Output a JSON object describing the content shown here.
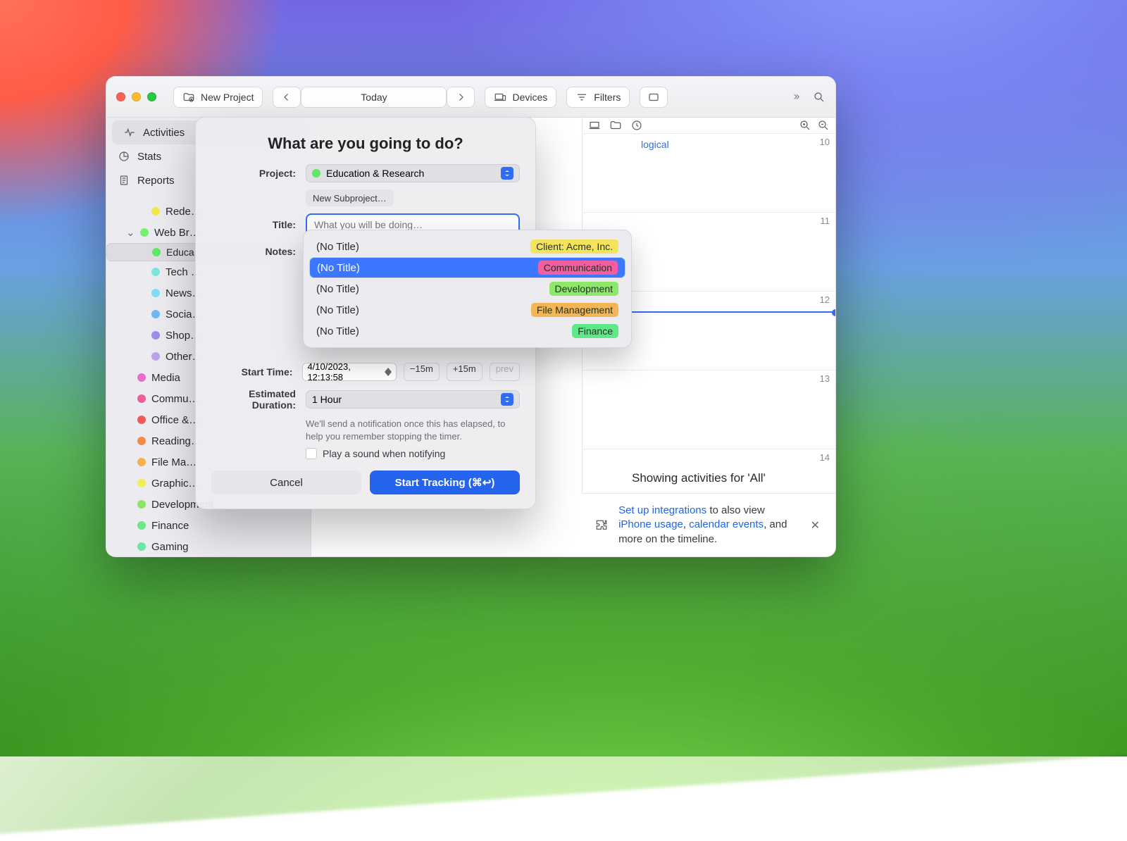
{
  "toolbar": {
    "new_project": "New Project",
    "today": "Today",
    "devices": "Devices",
    "filters": "Filters"
  },
  "sidebar": {
    "tabs": {
      "activities": "Activities",
      "stats": "Stats",
      "reports": "Reports"
    },
    "projects": [
      {
        "label": "Rede…",
        "color": "#f4e84e",
        "depth": 1
      },
      {
        "label": "Web Br…",
        "color": "#73f06e",
        "depth": 0,
        "expanded": true
      },
      {
        "label": "Educa…",
        "color": "#62e76a",
        "depth": 1,
        "selected": true
      },
      {
        "label": "Tech …",
        "color": "#7de7df",
        "depth": 1
      },
      {
        "label": "News…",
        "color": "#7fe0f3",
        "depth": 1
      },
      {
        "label": "Socia…",
        "color": "#6fb9f3",
        "depth": 1
      },
      {
        "label": "Shop…",
        "color": "#9a8df1",
        "depth": 1
      },
      {
        "label": "Other…",
        "color": "#bda3ec",
        "depth": 1
      },
      {
        "label": "Media",
        "color": "#e76fd0",
        "depth": 0
      },
      {
        "label": "Commu…",
        "color": "#ee5e99",
        "depth": 0
      },
      {
        "label": "Office &…",
        "color": "#f05a5a",
        "depth": 0
      },
      {
        "label": "Reading…",
        "color": "#f28a48",
        "depth": 0
      },
      {
        "label": "File Ma…",
        "color": "#f3b24a",
        "depth": 0
      },
      {
        "label": "Graphic…",
        "color": "#eeee57",
        "depth": 0
      },
      {
        "label": "Development",
        "color": "#8ae766",
        "depth": 0
      },
      {
        "label": "Finance",
        "color": "#6be785",
        "depth": 0
      },
      {
        "label": "Gaming",
        "color": "#6ae7a4",
        "depth": 0
      }
    ]
  },
  "timeline": {
    "hours": [
      "10",
      "11",
      "12",
      "13",
      "14"
    ]
  },
  "promo": {
    "prefix": "Set up integrations",
    "mid1": " to also view ",
    "lnk_iphone": "iPhone usage",
    "sep": ", ",
    "lnk_cal": "calendar events",
    "suffix": ", and more on the timeline."
  },
  "modal": {
    "heading": "What are you going to do?",
    "project_label": "Project:",
    "project_value": "Education & Research",
    "project_color": "#63e56c",
    "new_subproject": "New Subproject…",
    "title_label": "Title:",
    "title_placeholder": "What you will be doing…",
    "notes_label": "Notes:",
    "start_label": "Start Time:",
    "start_value": "4/10/2023, 12:13:58",
    "minus15": "−15m",
    "plus15": "+15m",
    "prev": "prev",
    "duration_label": "Estimated Duration:",
    "duration_value": "1 Hour",
    "hint": "We'll send a notification once this has elapsed, to help you remember stopping the timer.",
    "sound_label": "Play a sound when notifying",
    "cancel": "Cancel",
    "start": "Start Tracking (⌘↩︎)"
  },
  "suggestions": [
    {
      "title": "(No Title)",
      "tag": "Client: Acme, Inc.",
      "tag_bg": "#f4e35b"
    },
    {
      "title": "(No Title)",
      "tag": "Communication",
      "tag_bg": "#f15fa1",
      "selected": true
    },
    {
      "title": "(No Title)",
      "tag": "Development",
      "tag_bg": "#8de76b"
    },
    {
      "title": "(No Title)",
      "tag": "File Management",
      "tag_bg": "#f3b556"
    },
    {
      "title": "(No Title)",
      "tag": "Finance",
      "tag_bg": "#5fe88b"
    }
  ],
  "behind": {
    "tag": "logical",
    "filter_all": "'All'"
  }
}
